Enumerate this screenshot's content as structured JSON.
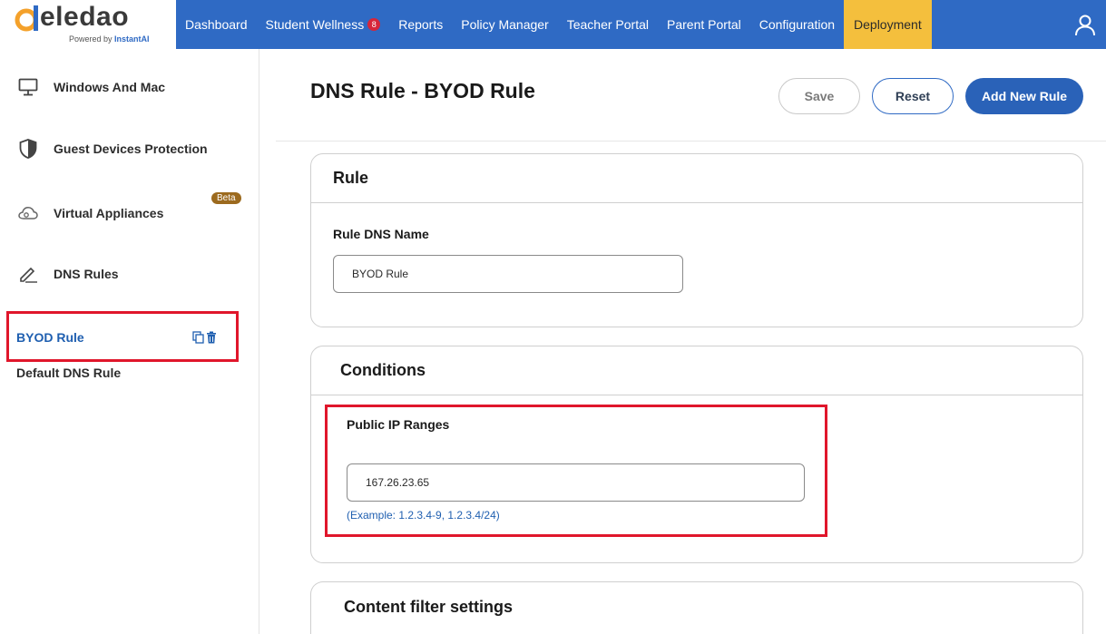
{
  "brand": {
    "name": "eledao",
    "powered_by": "Powered by",
    "powered_brand": "InstantAI"
  },
  "nav": {
    "items": [
      {
        "label": "Dashboard"
      },
      {
        "label": "Student Wellness",
        "badge": "8"
      },
      {
        "label": "Reports"
      },
      {
        "label": "Policy Manager"
      },
      {
        "label": "Teacher Portal"
      },
      {
        "label": "Parent Portal"
      },
      {
        "label": "Configuration"
      },
      {
        "label": "Deployment",
        "active": true
      }
    ]
  },
  "sidebar": {
    "items": [
      {
        "label": "Windows And Mac",
        "icon": "monitor-icon"
      },
      {
        "label": "Guest Devices Protection",
        "icon": "shield-icon"
      },
      {
        "label": "Virtual Appliances",
        "icon": "cloud-icon",
        "badge": "Beta"
      },
      {
        "label": "DNS Rules",
        "icon": "pencil-icon"
      }
    ],
    "rules": [
      {
        "label": "BYOD Rule",
        "selected": true
      },
      {
        "label": "Default DNS Rule",
        "selected": false
      }
    ]
  },
  "main": {
    "title": "DNS Rule - BYOD Rule",
    "buttons": {
      "save": "Save",
      "reset": "Reset",
      "add_new": "Add New Rule"
    },
    "rule_card": {
      "title": "Rule",
      "field_label": "Rule DNS Name",
      "field_value": "BYOD Rule"
    },
    "conditions_card": {
      "title": "Conditions",
      "field_label": "Public IP Ranges",
      "field_value": "167.26.23.65",
      "hint": "(Example: 1.2.3.4-9, 1.2.3.4/24)"
    },
    "content_filter_card": {
      "title": "Content filter settings"
    }
  },
  "colors": {
    "nav_bg": "#2f6ac4",
    "nav_active": "#f4bf3d",
    "primary_button": "#2a62b8",
    "highlight": "#e0162b",
    "link_blue": "#1f5fb0",
    "beta_badge": "#9c6a1e"
  }
}
